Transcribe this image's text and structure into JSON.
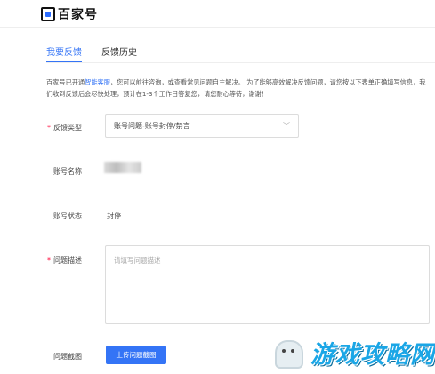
{
  "header": {
    "logo_text": "百家号"
  },
  "tabs": [
    {
      "label": "我要反馈",
      "active": true
    },
    {
      "label": "反馈历史",
      "active": false
    }
  ],
  "intro": {
    "prefix": "百家号已开通",
    "link": "智能客服",
    "suffix": "，您可以前往咨询，或查看常见问题自主解决。 为了能够高效解决反馈问题，请您按以下表单正确填写信息，我们收到反馈后会尽快处理，预计在1-3个工作日答复您，请您耐心等待，谢谢！"
  },
  "form": {
    "feedback_type": {
      "label": "反馈类型",
      "value": "账号问题-账号封停/禁言",
      "required": true
    },
    "account_name": {
      "label": "账号名称"
    },
    "account_status": {
      "label": "账号状态",
      "value": "封停"
    },
    "problem_desc": {
      "label": "问题描述",
      "placeholder": "请填写问题描述",
      "required": true
    },
    "problem_screenshot": {
      "label": "问题截图",
      "button": "上传问题截图"
    }
  },
  "colors": {
    "accent": "#3474f6",
    "required": "#ff0033"
  },
  "watermark": {
    "text": "游戏攻略网"
  }
}
